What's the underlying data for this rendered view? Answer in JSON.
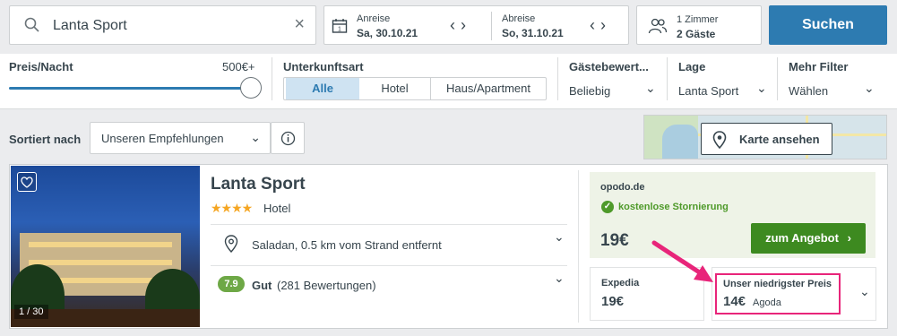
{
  "search": {
    "value": "Lanta Sport"
  },
  "dates": {
    "checkin_label": "Anreise",
    "checkin_value": "Sa, 30.10.21",
    "checkout_label": "Abreise",
    "checkout_value": "So, 31.10.21"
  },
  "rooms": {
    "line1": "1 Zimmer",
    "line2": "2 Gäste"
  },
  "search_button": "Suchen",
  "filters": {
    "price": {
      "title": "Preis/Nacht",
      "max": "500€+",
      "level_percent": 100
    },
    "type": {
      "title": "Unterkunftsart",
      "options": [
        "Alle",
        "Hotel",
        "Haus/Apartment"
      ],
      "selected": "Alle"
    },
    "rating": {
      "title": "Gästebewert...",
      "value": "Beliebig"
    },
    "location": {
      "title": "Lage",
      "value": "Lanta Sport"
    },
    "more": {
      "title": "Mehr Filter",
      "value": "Wählen"
    }
  },
  "sort": {
    "label": "Sortiert nach",
    "value": "Unseren Empfehlungen"
  },
  "map_button": "Karte ansehen",
  "hotel": {
    "name": "Lanta Sport",
    "stars": "★★★★",
    "star_count": 4,
    "type": "Hotel",
    "photo_counter": "1 / 30",
    "location": "Saladan, 0.5 km vom Strand entfernt",
    "rating_score": "7.9",
    "rating_word": "Gut",
    "rating_count": "(281 Bewertungen)"
  },
  "offers": {
    "main": {
      "provider": "opodo.de",
      "badge": "kostenlose Stornierung",
      "price": "19€",
      "button": "zum Angebot"
    },
    "expedia": {
      "provider": "Expedia",
      "price": "19€"
    },
    "lowest": {
      "label": "Unser niedrigster Preis",
      "price": "14€",
      "provider": "Agoda"
    }
  },
  "colors": {
    "accent": "#2d7bb1",
    "deal_green": "#3d8a20",
    "highlight_pink": "#e8257a",
    "rating_green": "#6ea846",
    "star_orange": "#f5a623"
  }
}
